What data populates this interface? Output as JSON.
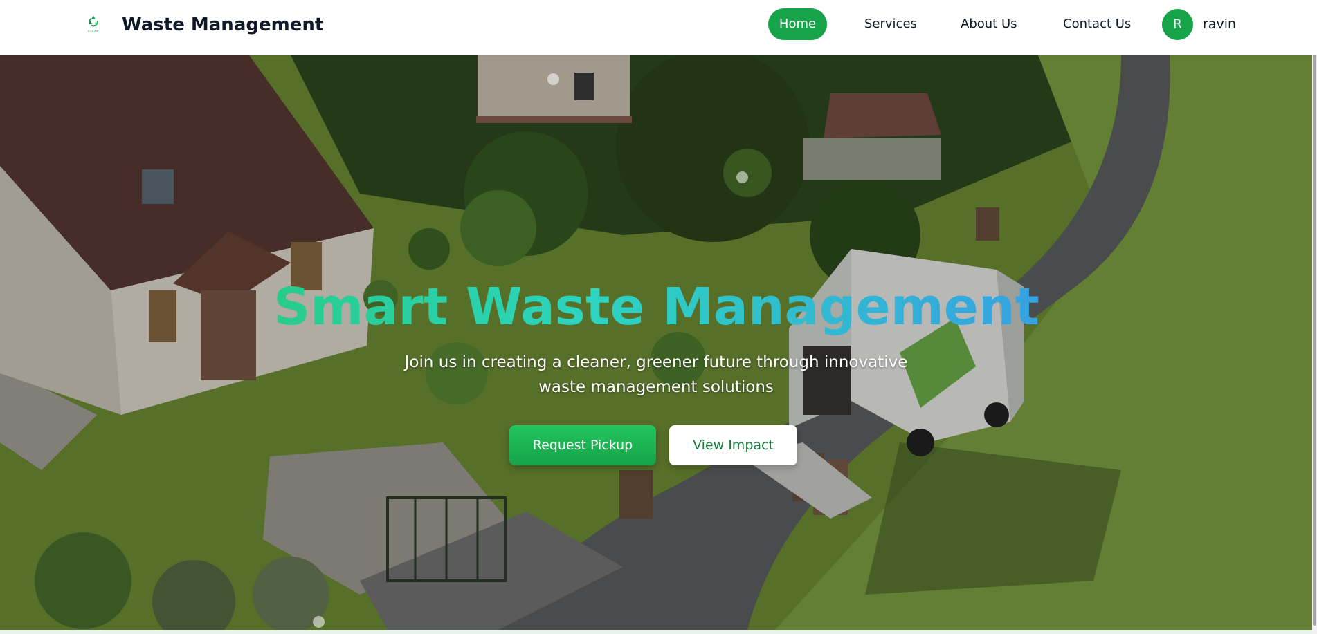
{
  "header": {
    "logo_icon": "recycle-icon",
    "logo_caption": "CLEAN",
    "title": "Waste Management",
    "nav": {
      "home": "Home",
      "services": "Services",
      "about": "About Us",
      "contact": "Contact Us"
    },
    "user": {
      "initial": "R",
      "name": "ravin"
    }
  },
  "hero": {
    "title": "Smart Waste Management",
    "subtitle": "Join us in creating a cleaner, greener future through innovative waste management solutions",
    "primary_button": "Request Pickup",
    "secondary_button": "View Impact"
  },
  "colors": {
    "brand_green": "#16a34a",
    "gradient_start": "#22c55e",
    "gradient_mid": "#2dd4bf",
    "gradient_end": "#3b82f6",
    "text_dark": "#111827"
  }
}
